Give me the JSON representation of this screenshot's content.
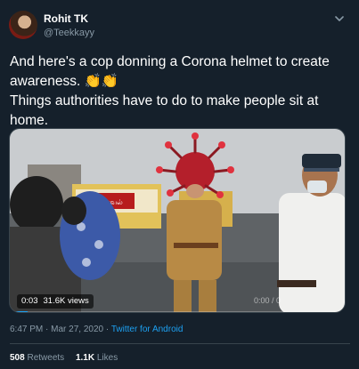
{
  "user": {
    "name": "Rohit TK",
    "handle": "@Teekkayy"
  },
  "tweet": {
    "line1": "And here's a cop donning a Corona helmet to create awareness. 👏👏",
    "line2": "Things authorities have to do to make people sit at home."
  },
  "video": {
    "duration": "0:03",
    "views": "31.6K views",
    "overlay_time": "0:00 / 0",
    "sign_text": "காவல்"
  },
  "meta": {
    "time": "6:47 PM",
    "separator": "·",
    "date": "Mar 27, 2020",
    "app": "Twitter for Android"
  },
  "stats": {
    "retweets_count": "508",
    "retweets_label": "Retweets",
    "likes_count": "1.1K",
    "likes_label": "Likes"
  },
  "colors": {
    "background": "#15202b",
    "secondary_text": "#8899a6",
    "link": "#1da1f2",
    "border": "#38444d"
  },
  "icons": [
    "avatar",
    "chevron-down-icon",
    "clap-emoji"
  ]
}
